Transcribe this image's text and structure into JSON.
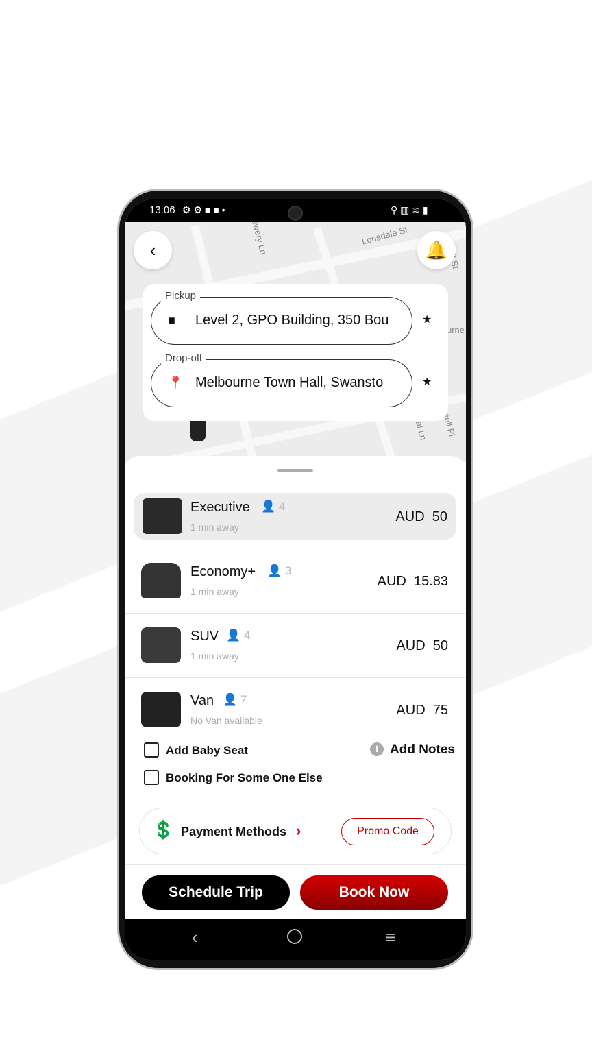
{
  "status_bar": {
    "time": "13:06"
  },
  "map": {
    "labels": [
      "Lonsdale St",
      "ewery Ln",
      "urne",
      "oyal Ln",
      "ssell Pl",
      "ll St"
    ]
  },
  "header": {
    "back_icon": "chevron-left-icon",
    "notification_icon": "bell-icon"
  },
  "locations": {
    "pickup": {
      "label": "Pickup",
      "value": "Level 2, GPO Building, 350 Bou",
      "icon": "square-stop-icon"
    },
    "dropoff": {
      "label": "Drop-off",
      "value": "Melbourne Town Hall, Swansto",
      "icon": "location-pin-icon"
    }
  },
  "vehicles": [
    {
      "name": "Executive",
      "seats": "4",
      "eta": "1 min away",
      "price": "AUD  50",
      "selected": true
    },
    {
      "name": "Economy+",
      "seats": "3",
      "eta": "1 min away",
      "price": "AUD  15.83"
    },
    {
      "name": "SUV",
      "seats": "4",
      "eta": "1 min away",
      "price": "AUD  50"
    },
    {
      "name": "Van",
      "seats": "7",
      "eta": "No Van available",
      "price": "AUD  75"
    }
  ],
  "options": {
    "baby_seat": "Add Baby Seat",
    "add_notes": "Add Notes",
    "booking_else": "Booking For Some One Else"
  },
  "payment": {
    "label": "Payment Methods",
    "promo": "Promo Code"
  },
  "actions": {
    "schedule": "Schedule Trip",
    "book": "Book Now"
  },
  "colors": {
    "accent": "#c40000",
    "dark": "#000000"
  }
}
